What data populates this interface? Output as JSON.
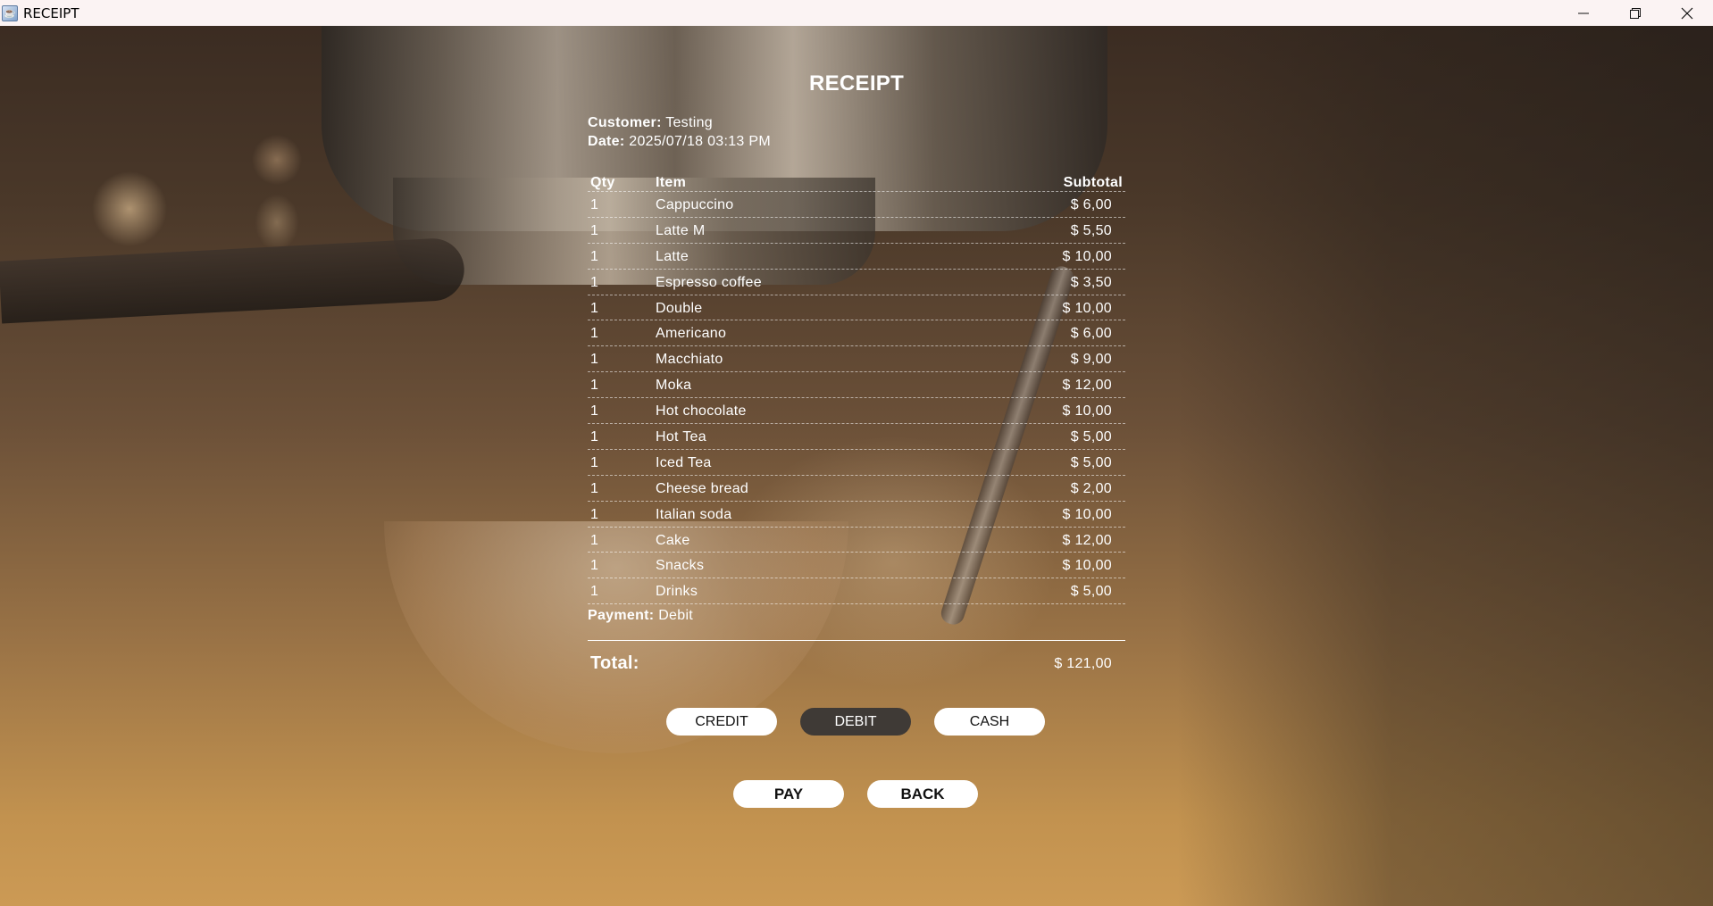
{
  "window": {
    "title": "RECEIPT",
    "controls": [
      "minimize",
      "restore",
      "close"
    ]
  },
  "receipt": {
    "title": "RECEIPT",
    "customer_label": "Customer:",
    "customer_value": "Testing",
    "date_label": "Date:",
    "date_value": "2025/07/18 03:13 PM",
    "columns": {
      "qty": "Qty",
      "item": "Item",
      "subtotal": "Subtotal"
    },
    "rows": [
      {
        "qty": "1",
        "item": "Cappuccino",
        "subtotal": "$ 6,00"
      },
      {
        "qty": "1",
        "item": "Latte M",
        "subtotal": "$ 5,50"
      },
      {
        "qty": "1",
        "item": "Latte",
        "subtotal": "$ 10,00"
      },
      {
        "qty": "1",
        "item": "Espresso coffee",
        "subtotal": "$ 3,50"
      },
      {
        "qty": "1",
        "item": "Double",
        "subtotal": "$ 10,00"
      },
      {
        "qty": "1",
        "item": "Americano",
        "subtotal": "$ 6,00"
      },
      {
        "qty": "1",
        "item": "Macchiato",
        "subtotal": "$ 9,00"
      },
      {
        "qty": "1",
        "item": "Moka",
        "subtotal": "$ 12,00"
      },
      {
        "qty": "1",
        "item": "Hot chocolate",
        "subtotal": "$ 10,00"
      },
      {
        "qty": "1",
        "item": "Hot Tea",
        "subtotal": "$ 5,00"
      },
      {
        "qty": "1",
        "item": "Iced Tea",
        "subtotal": "$ 5,00"
      },
      {
        "qty": "1",
        "item": "Cheese bread",
        "subtotal": "$ 2,00"
      },
      {
        "qty": "1",
        "item": "Italian soda",
        "subtotal": "$ 10,00"
      },
      {
        "qty": "1",
        "item": "Cake",
        "subtotal": "$ 12,00"
      },
      {
        "qty": "1",
        "item": "Snacks",
        "subtotal": "$ 10,00"
      },
      {
        "qty": "1",
        "item": "Drinks",
        "subtotal": "$ 5,00"
      }
    ],
    "payment_label": "Payment:",
    "payment_value": "Debit",
    "total_label": "Total:",
    "total_value": "$ 121,00"
  },
  "payment_methods": {
    "options": [
      "CREDIT",
      "DEBIT",
      "CASH"
    ],
    "selected": "DEBIT"
  },
  "actions": {
    "pay_label": "PAY",
    "back_label": "BACK"
  },
  "colors": {
    "titlebar_bg": "#fbf3f3",
    "selected_button_bg": "#3f3a36",
    "button_bg": "#ffffff",
    "text": "#ffffff"
  }
}
